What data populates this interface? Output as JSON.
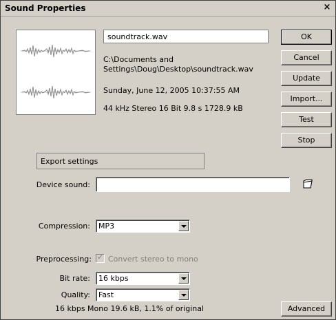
{
  "window": {
    "title": "Sound Properties",
    "close_glyph": "×"
  },
  "sound": {
    "filename": "soundtrack.wav",
    "path_line1": "C:\\Documents and",
    "path_line2": "Settings\\Doug\\Desktop\\soundtrack.wav",
    "date": "Sunday, June 12, 2005  10:37:55 AM",
    "format": "44 kHz Stereo 16 Bit 9.8 s 1728.9 kB"
  },
  "buttons": {
    "ok": "OK",
    "cancel": "Cancel",
    "update": "Update",
    "import": "Import...",
    "test": "Test",
    "stop": "Stop",
    "advanced": "Advanced"
  },
  "export": {
    "section_title": "Export settings",
    "device_sound_label": "Device sound:",
    "device_sound_value": "",
    "compression_label": "Compression:",
    "compression_value": "MP3",
    "preprocessing_label": "Preprocessing:",
    "convert_label": "Convert stereo to mono",
    "convert_checked": true,
    "bitrate_label": "Bit rate:",
    "bitrate_value": "16 kbps",
    "quality_label": "Quality:",
    "quality_value": "Fast",
    "summary": "16 kbps  Mono 19.6 kB, 1.1% of original"
  },
  "icons": {
    "waveform": "waveform-preview",
    "folder": "folder-icon",
    "dropdown": "chevron-down-icon"
  }
}
